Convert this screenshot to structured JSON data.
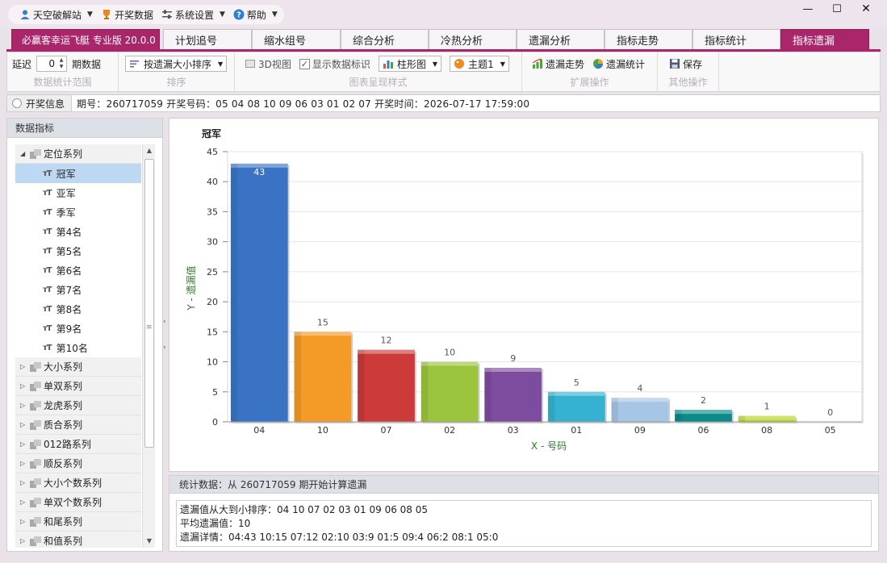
{
  "menu": {
    "user_label": "天空破解站",
    "draw_data_label": "开奖数据",
    "settings_label": "系统设置",
    "help_label": "帮助"
  },
  "window": {
    "minimize": "—",
    "maximize": "☐",
    "close": "✕"
  },
  "tabs": {
    "brand": "必赢客幸运飞艇 专业版 20.0.0",
    "items": [
      "计划追号",
      "缩水组号",
      "综合分析",
      "冷热分析",
      "遗漏分析",
      "指标走势",
      "指标统计",
      "指标遗漏"
    ],
    "active_index": 7
  },
  "toolbar": {
    "delay_label": "延迟",
    "delay_value": "0",
    "period_data_label": "期数据",
    "group1_caption": "数据统计范围",
    "sort_dropdown": "按遗漏大小排序",
    "group2_caption": "排序",
    "view3d_label": "3D视图",
    "show_labels_label": "显示数据标识",
    "chart_type": "柱形图",
    "theme": "主题1",
    "group3_caption": "图表呈现样式",
    "trend_button": "遗漏走势",
    "stats_button": "遗漏统计",
    "group4_caption": "扩展操作",
    "save_button": "保存",
    "group5_caption": "其他操作"
  },
  "info": {
    "button_label": "开奖信息",
    "text": "期号：260717059  开奖号码：05 04 08 10 09 06 03 01 02 07  开奖时间：2026-07-17 17:59:00"
  },
  "left": {
    "header": "数据指标",
    "group_expanded": "定位系列",
    "leaves": [
      "冠军",
      "亚军",
      "季军",
      "第4名",
      "第5名",
      "第6名",
      "第7名",
      "第8名",
      "第9名",
      "第10名"
    ],
    "selected_leaf": "冠军",
    "groups": [
      "大小系列",
      "单双系列",
      "龙虎系列",
      "质合系列",
      "012路系列",
      "顺反系列",
      "大小个数系列",
      "单双个数系列",
      "和尾系列",
      "和值系列"
    ]
  },
  "chart_data": {
    "type": "bar",
    "title": "冠军",
    "xlabel": "X - 号码",
    "ylabel": "Y - 遗漏值",
    "categories": [
      "04",
      "10",
      "07",
      "02",
      "03",
      "01",
      "09",
      "06",
      "08",
      "05"
    ],
    "values": [
      43,
      15,
      12,
      10,
      9,
      5,
      4,
      2,
      1,
      0
    ],
    "ylim": [
      0,
      45
    ],
    "yticks": [
      0,
      5,
      10,
      15,
      20,
      25,
      30,
      35,
      40,
      45
    ],
    "colors": [
      "#3a73c4",
      "#f39a27",
      "#cc3a3a",
      "#9cc43c",
      "#7e4c9e",
      "#35b2d2",
      "#a6c6e6",
      "#0c8a8a",
      "#b9d41e",
      "#cccccc"
    ],
    "grid": true,
    "legend": "none"
  },
  "stats": {
    "header": "统计数据：从 260717059 期开始计算遗漏",
    "line1": "遗漏值从大到小排序：04 10 07 02 03 01 09 06 08 05",
    "line2": "平均遗漏值：10",
    "line3": "遗漏详情：04:43  10:15  07:12  02:10  03:9  01:5  09:4  06:2  08:1  05:0"
  }
}
